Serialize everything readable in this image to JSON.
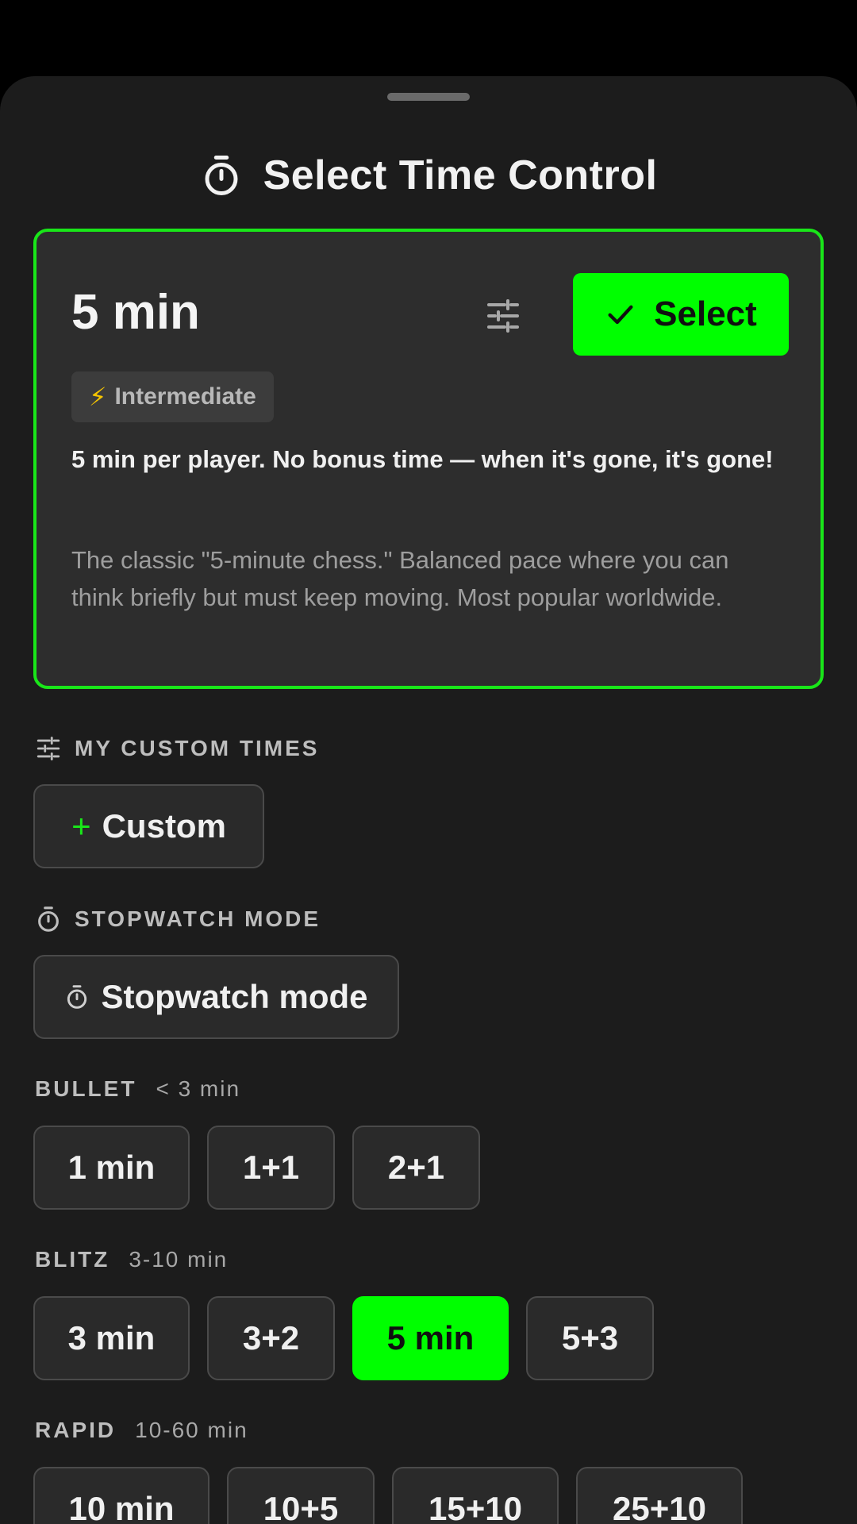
{
  "sheet": {
    "title": "Select Time Control"
  },
  "selected": {
    "time": "5 min",
    "select_label": "Select",
    "level": "Intermediate",
    "summary": "5 min per player. No bonus time — when it's gone, it's gone!",
    "description": "The classic \"5-minute chess.\" Balanced pace where you can think briefly but must keep moving. Most popular worldwide."
  },
  "custom": {
    "header": "MY CUSTOM TIMES",
    "button_label": "Custom"
  },
  "stopwatch": {
    "header": "STOPWATCH MODE",
    "button_label": "Stopwatch mode"
  },
  "bullet": {
    "header": "BULLET",
    "range": "< 3 min",
    "options": [
      "1 min",
      "1+1",
      "2+1"
    ]
  },
  "blitz": {
    "header": "BLITZ",
    "range": "3-10 min",
    "options": [
      "3 min",
      "3+2",
      "5 min",
      "5+3"
    ],
    "active_option": "5 min"
  },
  "rapid": {
    "header": "RAPID",
    "range": "10-60 min",
    "options": [
      "10 min",
      "10+5",
      "15+10",
      "25+10"
    ]
  },
  "colors": {
    "accent": "#00ff00",
    "accent_border": "#19e619",
    "sheet_bg": "#1c1c1c",
    "card_bg": "#2d2d2d"
  }
}
